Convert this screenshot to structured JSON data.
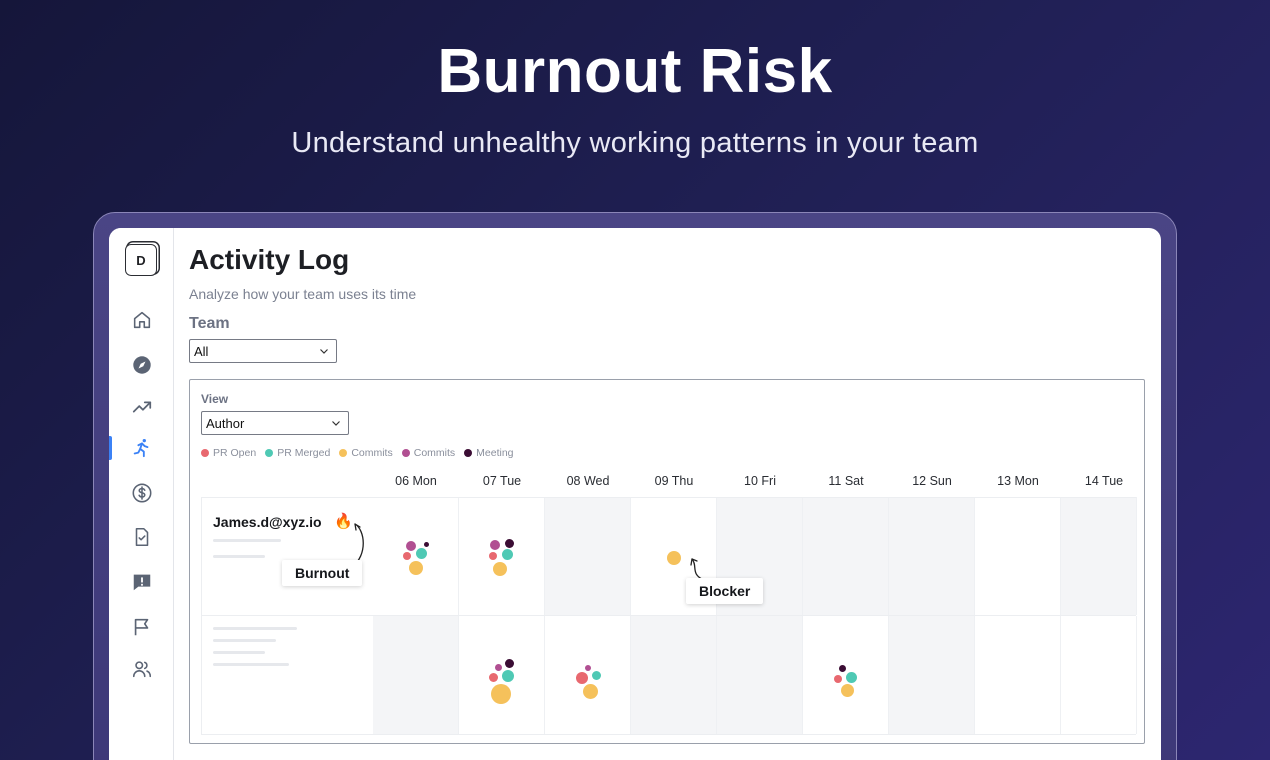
{
  "hero": {
    "title": "Burnout Risk",
    "subtitle": "Understand unhealthy working patterns in your team"
  },
  "sidebar": {
    "logo_letter": "D",
    "items": [
      {
        "name": "home-icon",
        "active": false
      },
      {
        "name": "compass-icon",
        "active": false
      },
      {
        "name": "trend-icon",
        "active": false
      },
      {
        "name": "running-person-icon",
        "active": true
      },
      {
        "name": "dollar-icon",
        "active": false
      },
      {
        "name": "checklist-icon",
        "active": false
      },
      {
        "name": "alert-message-icon",
        "active": false
      },
      {
        "name": "flag-icon",
        "active": false
      },
      {
        "name": "users-icon",
        "active": false
      }
    ]
  },
  "page": {
    "title": "Activity Log",
    "subtitle": "Analyze how your team uses its time",
    "team_label": "Team",
    "team_value": "All"
  },
  "panel": {
    "view_label": "View",
    "view_value": "Author",
    "legend": [
      {
        "label": "PR Open",
        "color": "#e8686f"
      },
      {
        "label": "PR Merged",
        "color": "#4fc9b4"
      },
      {
        "label": "Commits",
        "color": "#f5c15b"
      },
      {
        "label": "Commits",
        "color": "#b14f92"
      },
      {
        "label": "Meeting",
        "color": "#3b0d34"
      }
    ],
    "days": [
      "06 Mon",
      "07 Tue",
      "08 Wed",
      "09 Thu",
      "10 Fri",
      "11 Sat",
      "12 Sun",
      "13 Mon",
      "14 Tue"
    ],
    "rows": [
      {
        "author": "James.d@xyz.io",
        "flame": "🔥",
        "shaded_days": [
          2,
          4,
          5,
          6,
          8
        ]
      },
      {
        "author": "",
        "shaded_days": [
          0,
          3,
          4,
          6
        ]
      }
    ],
    "callouts": {
      "burnout": "Burnout",
      "blocker": "Blocker"
    }
  }
}
